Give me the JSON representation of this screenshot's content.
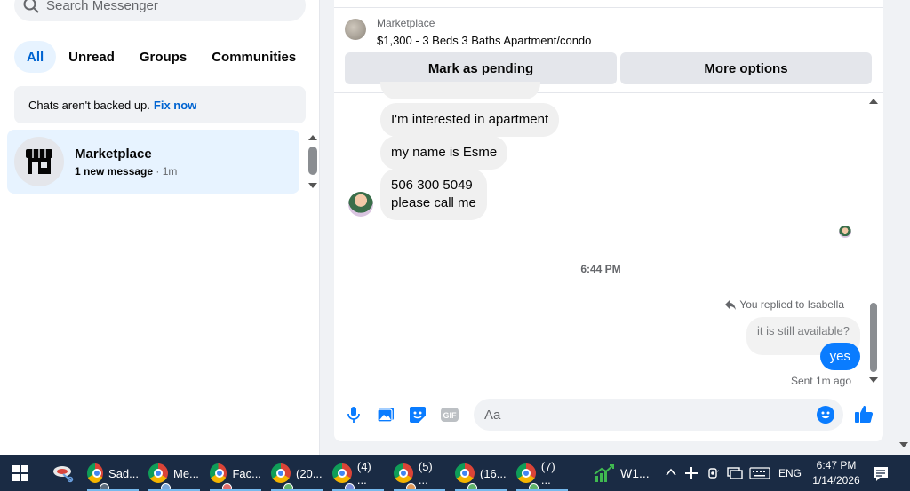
{
  "left": {
    "search_placeholder": "Search Messenger",
    "filters": [
      "All",
      "Unread",
      "Groups",
      "Communities"
    ],
    "backup_text": "Chats aren't backed up.",
    "backup_link": "Fix now",
    "chat": {
      "name": "Marketplace",
      "status": "1 new message",
      "time": "· 1m"
    }
  },
  "conversation": {
    "header_label": "Marketplace",
    "listing_title": "$1,300 - 3 Beds 3 Baths Apartment/condo",
    "btn_pending": "Mark as pending",
    "btn_more": "More options",
    "incoming": [
      "I'm interested in apartment",
      "my name is Esme",
      "506 300 5049",
      "please call me"
    ],
    "timestamp": "6:44 PM",
    "replied_to": "You replied to Isabella",
    "quoted": "it is still available?",
    "outgoing": "yes",
    "sent_status": "Sent 1m ago",
    "composer_placeholder": "Aa"
  },
  "taskbar": {
    "apps": [
      {
        "label": "Sad..."
      },
      {
        "label": "Me..."
      },
      {
        "label": "Fac..."
      },
      {
        "label": "(20..."
      },
      {
        "label": "(4) ..."
      },
      {
        "label": "(5) ..."
      },
      {
        "label": "(16..."
      },
      {
        "label": "(7) ..."
      }
    ],
    "stock_label": "W1...",
    "lang": "ENG",
    "time": "6:47 PM",
    "date": "1/14/2026"
  },
  "colors": {
    "accent": "#0a7cff",
    "link": "#0064d1",
    "taskbar": "#1a2b44"
  }
}
